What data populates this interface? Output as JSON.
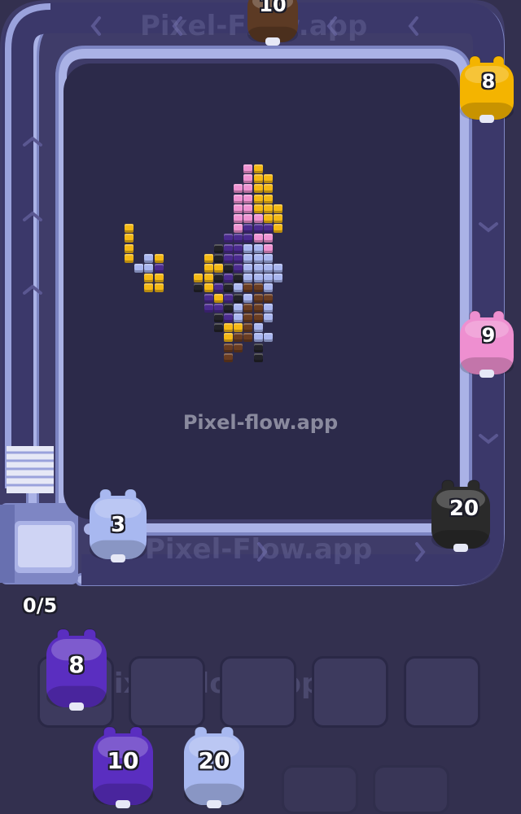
{
  "watermark": "Pixel-flow.app",
  "faint_watermark": "Pixel-Flow.app",
  "counter": "0/5",
  "conveyor_shooters": [
    {
      "id": "top",
      "value": "10",
      "color": "#5c3a24"
    },
    {
      "id": "right-top",
      "value": "8",
      "color": "#f4b400"
    },
    {
      "id": "right-mid",
      "value": "9",
      "color": "#ee8fd0"
    },
    {
      "id": "bottom-right",
      "value": "20",
      "color": "#2a2a2a"
    },
    {
      "id": "bottom-left",
      "value": "3",
      "color": "#a8b8f0"
    }
  ],
  "queue": [
    {
      "id": "q1",
      "value": "8",
      "color": "#5a2ec0"
    },
    {
      "id": "q2",
      "value": "10",
      "color": "#5a2ec0"
    },
    {
      "id": "q3",
      "value": "20",
      "color": "#a8b8f0"
    }
  ],
  "colors": {
    "conveyor": "#a6aee0",
    "conveyor_dark": "#6c74b4",
    "board": "#2c2a4a",
    "background": "#33304f",
    "yellow": "#f5b915",
    "pink": "#ef93d2",
    "lavender": "#a9b6ef",
    "purple": "#4b2b8e",
    "black": "#23232a",
    "brown": "#6a3d22"
  }
}
